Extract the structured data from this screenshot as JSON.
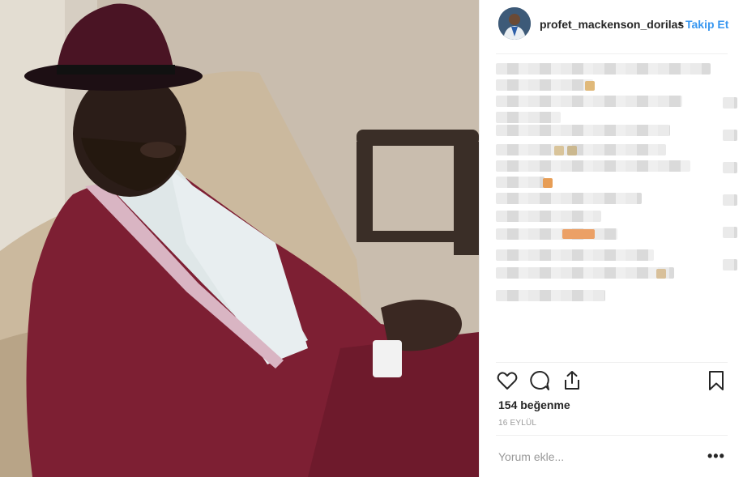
{
  "post": {
    "username": "profet_mackenson_dorilas",
    "separator": "•",
    "follow_label": "Takip Et",
    "likes_text": "154 beğenme",
    "date_text": "16 EYLÜL",
    "comment_placeholder": "Yorum ekle...",
    "more_label": "•••"
  },
  "icons": {
    "like": "heart-icon",
    "comment": "comment-icon",
    "share": "share-icon",
    "save": "bookmark-icon"
  },
  "colors": {
    "accent": "#3897f0",
    "text": "#262626",
    "muted": "#999999",
    "divider": "#efefef"
  }
}
